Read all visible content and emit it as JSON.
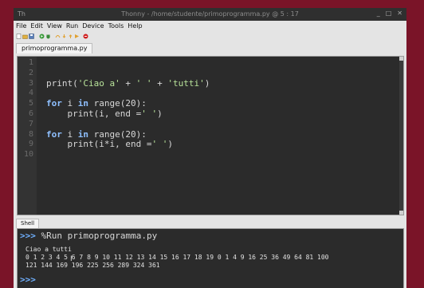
{
  "window": {
    "title": "Thonny  -  /home/studente/primoprogramma.py  @  5 : 17",
    "app_icon": "Th",
    "controls": [
      "_",
      "□",
      "✕"
    ]
  },
  "menubar": {
    "items": [
      "File",
      "Edit",
      "View",
      "Run",
      "Device",
      "Tools",
      "Help"
    ]
  },
  "toolbar": {
    "icons": [
      "new-file-icon",
      "open-file-icon",
      "save-file-icon",
      "run-icon",
      "debug-icon",
      "step-over-icon",
      "step-into-icon",
      "step-out-icon",
      "resume-icon",
      "stop-icon"
    ]
  },
  "editor": {
    "tab_label": "primoprogramma.py",
    "line_numbers": [
      "1",
      "2",
      "3",
      "4",
      "5",
      "6",
      "7",
      "8",
      "9",
      "10"
    ]
  },
  "shell": {
    "tab_label": "Shell",
    "prompt": ">>>",
    "run_command": "%Run primoprogramma.py",
    "output": [
      "Ciao a tutti",
      "0 1 2 3 4 5 6 7 8 9 10 11 12 13 14 15 16 17 18 19 0 1 4 9 16 25 36 49 64 81 100",
      "121 144 169 196 225 256 289 324 361"
    ]
  },
  "colors": {
    "desktop": "#7a1428",
    "editor_bg": "#2b2b2b",
    "keyword": "#8fc0ff",
    "string": "#b8e39a",
    "prompt": "#6fb0ff"
  }
}
